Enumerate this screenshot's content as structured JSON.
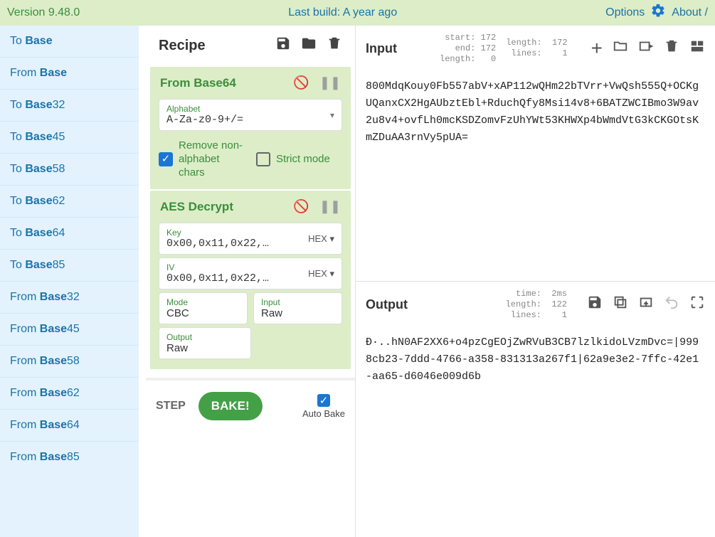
{
  "banner": {
    "version": "Version 9.48.0",
    "build": "Last build: A year ago",
    "options": "Options",
    "about": "About /"
  },
  "sidebar": {
    "items": [
      {
        "pre": "To ",
        "bold": "Base"
      },
      {
        "pre": "From ",
        "bold": "Base"
      },
      {
        "pre": "To ",
        "bold": "Base",
        "post": "32"
      },
      {
        "pre": "To ",
        "bold": "Base",
        "post": "45"
      },
      {
        "pre": "To ",
        "bold": "Base",
        "post": "58"
      },
      {
        "pre": "To ",
        "bold": "Base",
        "post": "62"
      },
      {
        "pre": "To ",
        "bold": "Base",
        "post": "64"
      },
      {
        "pre": "To ",
        "bold": "Base",
        "post": "85"
      },
      {
        "pre": "From ",
        "bold": "Base",
        "post": "32"
      },
      {
        "pre": "From ",
        "bold": "Base",
        "post": "45"
      },
      {
        "pre": "From ",
        "bold": "Base",
        "post": "58"
      },
      {
        "pre": "From ",
        "bold": "Base",
        "post": "62"
      },
      {
        "pre": "From ",
        "bold": "Base",
        "post": "64"
      },
      {
        "pre": "From ",
        "bold": "Base",
        "post": "85"
      }
    ]
  },
  "recipe": {
    "title": "Recipe",
    "op1": {
      "title": "From Base64",
      "alphabet_label": "Alphabet",
      "alphabet_value": "A-Za-z0-9+/=",
      "remove_label": "Remove non-alphabet chars",
      "strict_label": "Strict mode"
    },
    "op2": {
      "title": "AES Decrypt",
      "key_label": "Key",
      "key_value": "0x00,0x11,0x22,…",
      "key_type": "HEX",
      "iv_label": "IV",
      "iv_value": "0x00,0x11,0x22,…",
      "iv_type": "HEX",
      "mode_label": "Mode",
      "mode_value": "CBC",
      "input_label": "Input",
      "input_value": "Raw",
      "output_label": "Output",
      "output_value": "Raw"
    },
    "step": "STEP",
    "bake": "BAKE!",
    "auto_bake": "Auto Bake"
  },
  "input": {
    "title": "Input",
    "stats1": "start: 172\n  end: 172\nlength:   0",
    "stats2": "length:  172\n lines:    1",
    "text": "800MdqKouy0Fb557abV+xAP112wQHm22bTVrr+VwQsh555Q+OCKgUQanxCX2HgAUbztEbl+RduchQfy8Msi14v8+6BATZWCIBmo3W9av2u8v4+ovfLh0mcKSDZomvFzUhYWt53KHWXp4bWmdVtG3kCKGOtsKmZDuAA3rnVy5pUA="
  },
  "output": {
    "title": "Output",
    "stats": "  time:  2ms\nlength:  122\n lines:    1",
    "text": "Ð·..hN0AF2XX6+o4pzCgEOjZwRVuB3CB7lzlkidoLVzmDvc=|9998cb23-7ddd-4766-a358-831313a267f1|62a9e3e2-7ffc-42e1-aa65-d6046e009d6b"
  }
}
